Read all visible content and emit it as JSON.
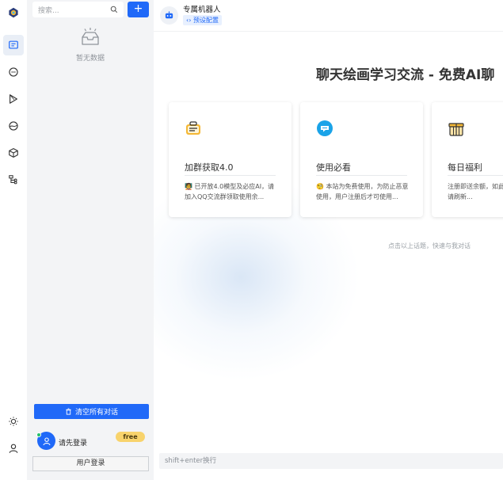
{
  "sidebar": {
    "search_placeholder": "搜索...",
    "add_label": "+",
    "empty_text": "暂无数据",
    "clear_label": "清空所有对话",
    "user_name": "请先登录",
    "badge": "free",
    "login_label": "用户登录"
  },
  "header": {
    "bot_name": "专属机器人",
    "preset_label": "预设配置"
  },
  "main": {
    "title": "聊天绘画学习交流 - 免费AI聊",
    "hint": "点击以上话题，快速与我对话",
    "input_placeholder": "shift+enter换行"
  },
  "cards": [
    {
      "title": "加群获取4.0",
      "desc": "🧑‍🏫 已开放4.0模型及必应AI，请加入QQ交流群领取使用余..."
    },
    {
      "title": "使用必看",
      "desc": "🧐 本站为免费使用，为防止恶意使用，用户注册后才可使用..."
    },
    {
      "title": "每日福利",
      "desc": "注册即送余额，如此显示内容，请刷新..."
    }
  ],
  "colors": {
    "accent": "#2069f8",
    "badge": "#f8d36c"
  }
}
